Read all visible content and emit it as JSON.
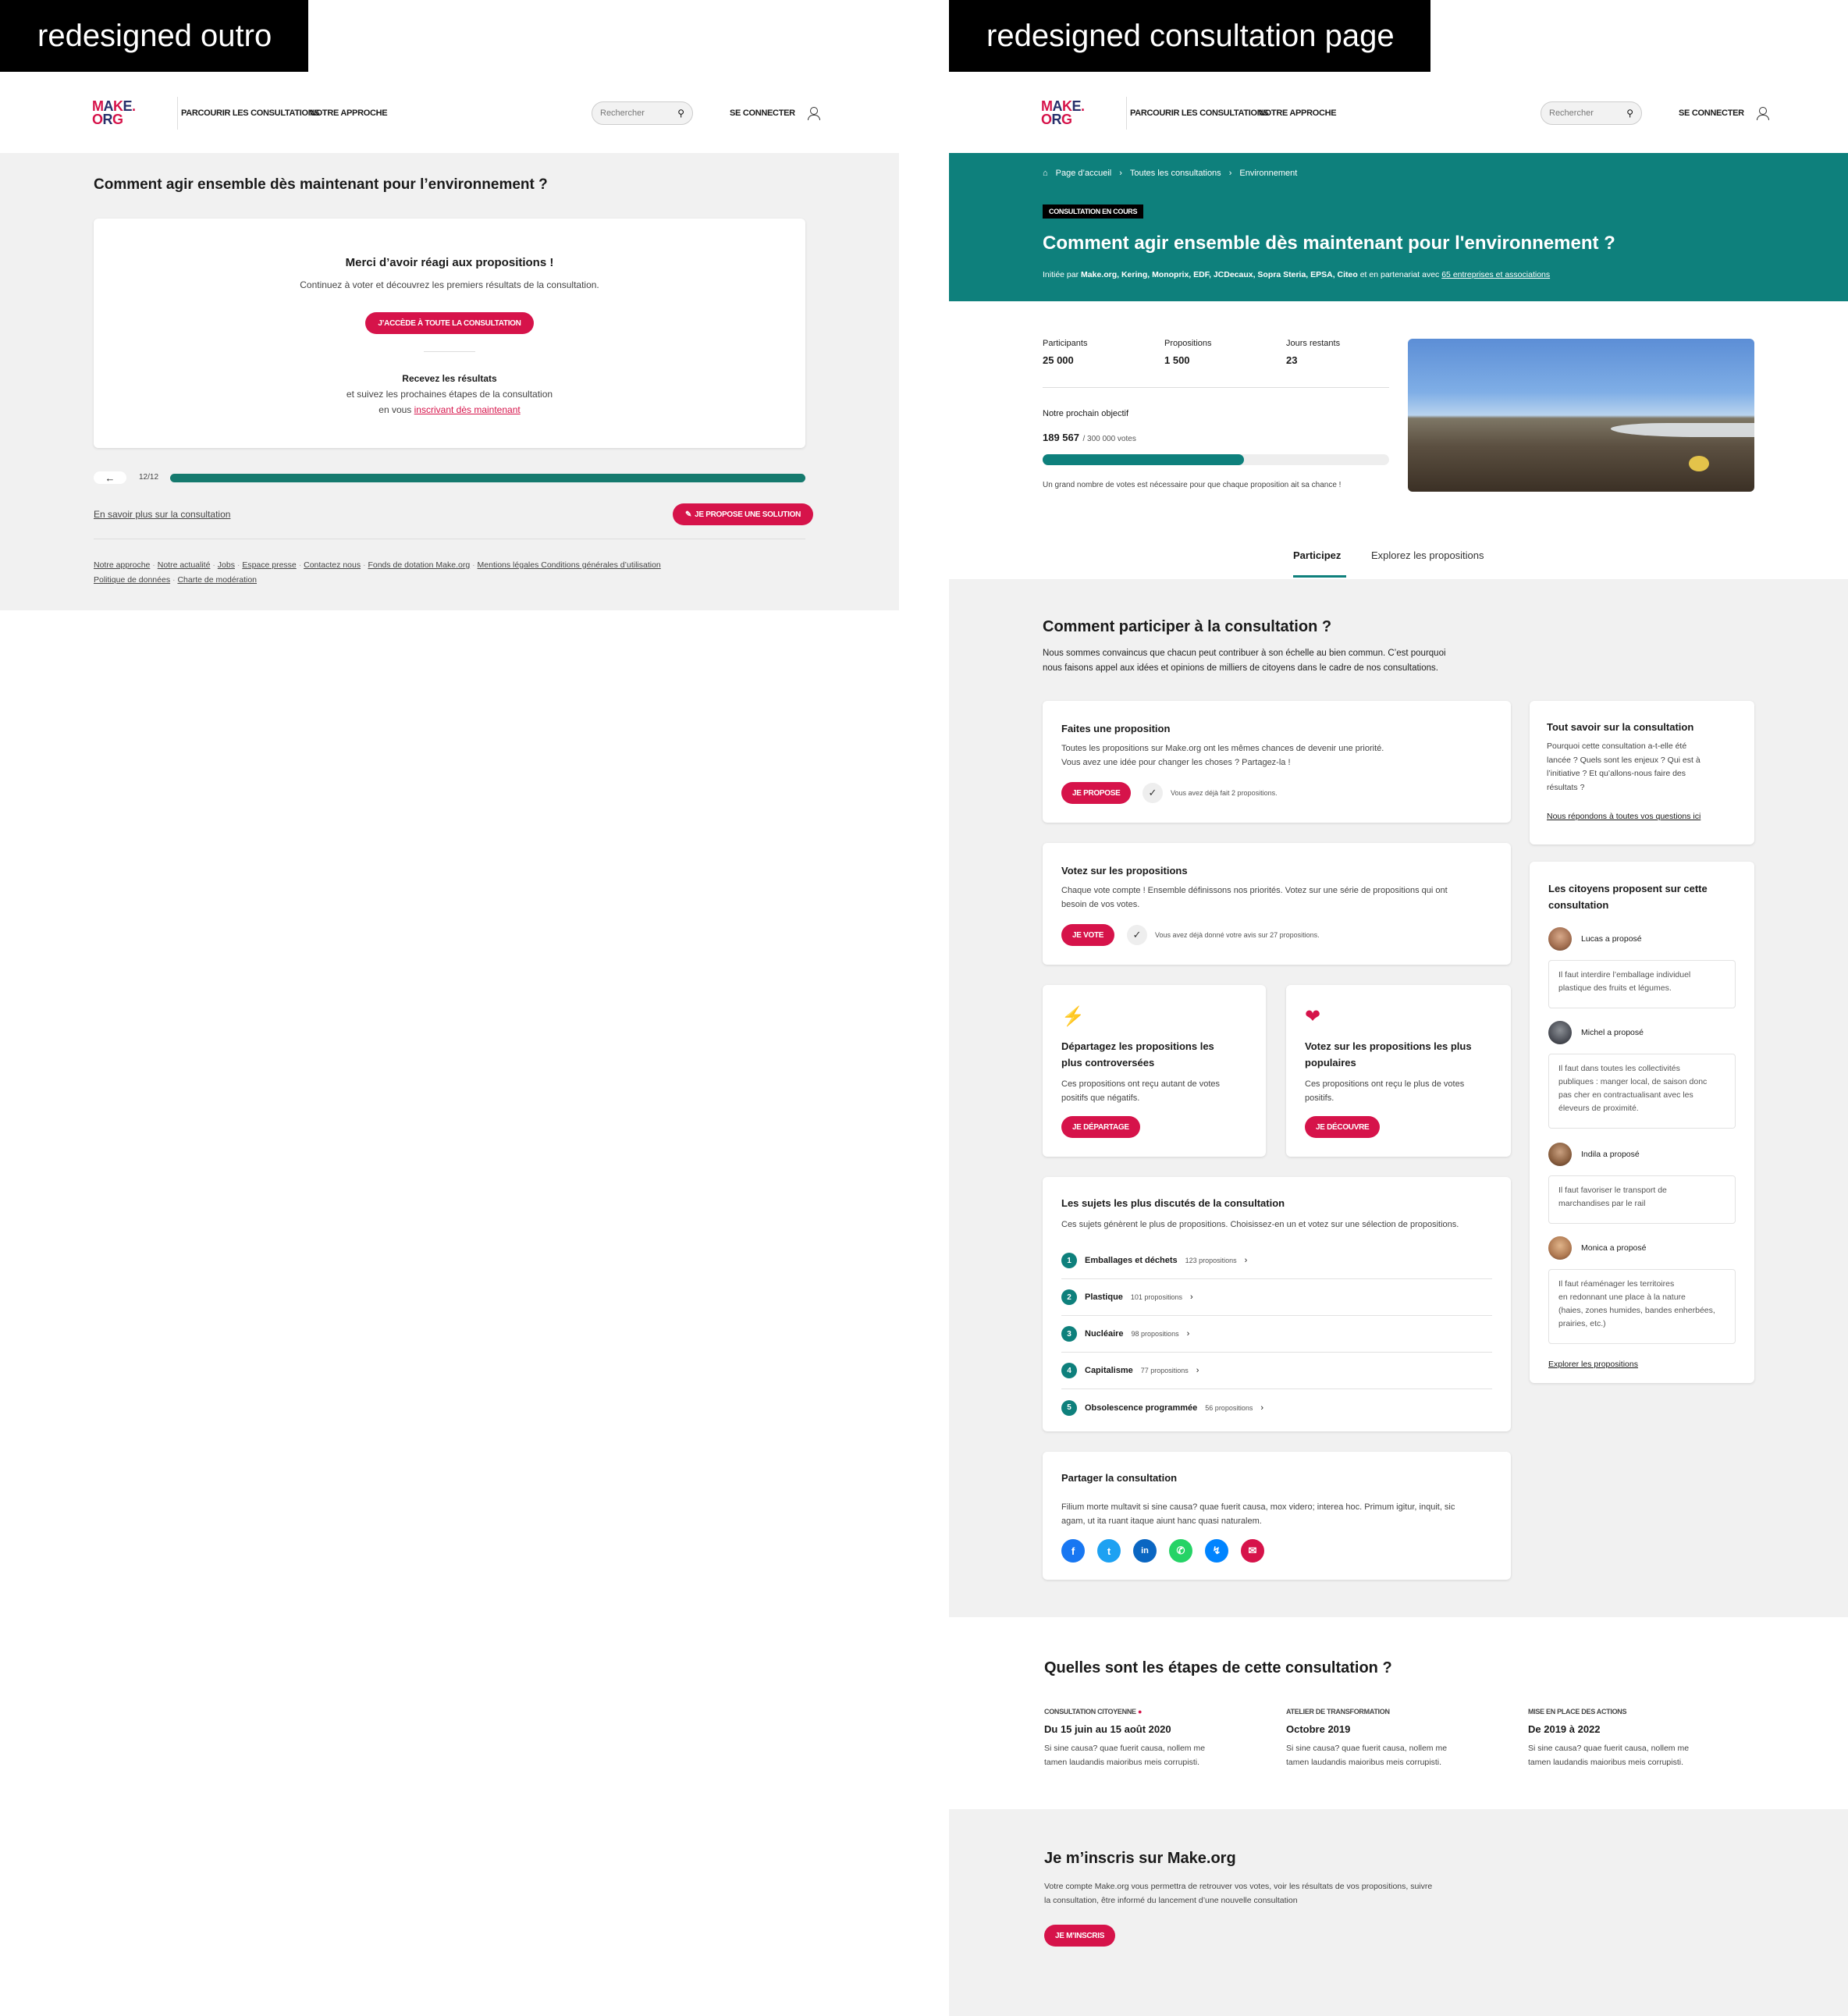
{
  "labels": {
    "left": "redesigned outro",
    "right": "redesigned consultation page"
  },
  "header": {
    "logo_top": "MAKE.",
    "logo_bottom": "ORG",
    "nav": [
      "PARCOURIR LES CONSULTATIONS",
      "NOTRE APPROCHE"
    ],
    "search_placeholder": "Rechercher",
    "login": "SE CONNECTER"
  },
  "outro": {
    "title": "Comment agir ensemble dès maintenant pour l’environnement ?",
    "thanks_title": "Merci d’avoir réagi aux propositions !",
    "thanks_text": "Continuez à voter et découvrez les premiers résultats de la consultation.",
    "access_button": "J’ACCÈDE À TOUTE LA CONSULTATION",
    "results_title": "Recevez les résultats",
    "results_line1": "et suivez les prochaines étapes de la consultation",
    "results_line2_prefix": "en vous",
    "results_link": "inscrivant dès maintenant",
    "progress_label": "12/12",
    "progress_fraction": 1.0,
    "learn_more": "En savoir plus sur la consultation",
    "propose_button": "JE PROPOSE UNE SOLUTION",
    "footer_links_row1": [
      "Notre approche",
      "Notre actualité",
      "Jobs",
      "Espace presse",
      "Contactez nous",
      "Fonds de dotation Make.org",
      "Mentions légales Conditions générales d’utilisation"
    ],
    "footer_links_row2": [
      "Politique de données",
      "Charte de modération"
    ]
  },
  "page": {
    "breadcrumb": [
      "Page d’accueil",
      "Toutes les consultations",
      "Environnement"
    ],
    "status_tag": "CONSULTATION EN COURS",
    "title": "Comment agir ensemble dès maintenant pour l'environnement ?",
    "initiated_prefix": "Initiée par",
    "initiated_by": "Make.org, Kering, Monoprix, EDF, JCDecaux, Sopra Steria, EPSA, Citeo",
    "partner_text": "et en partenariat avec",
    "partner_link": "65 entreprises et associations",
    "stats": [
      {
        "label": "Participants",
        "value": "25 000"
      },
      {
        "label": "Propositions",
        "value": "1 500"
      },
      {
        "label": "Jours restants",
        "value": "23"
      }
    ],
    "objective_label": "Notre prochain objectif",
    "objective_value": "189 567",
    "objective_total": "/ 300 000 votes",
    "objective_fraction": 0.58,
    "objective_note": "Un grand nombre de votes est nécessaire pour que chaque proposition ait sa chance !",
    "tabs": [
      "Participez",
      "Explorez les propositions"
    ],
    "participate_title": "Comment participer à la consultation ?",
    "participate_text1": "Nous sommes convaincus que chacun peut contribuer à son échelle au bien commun. C’est pourquoi",
    "participate_text2": "nous faisons appel aux idées et opinions de milliers de citoyens dans le cadre de nos consultations.",
    "propose": {
      "title": "Faites une proposition",
      "text1": "Toutes les propositions sur Make.org ont les mêmes chances de devenir une priorité.",
      "text2": "Vous avez une idée pour changer les choses ? Partagez-la !",
      "button": "JE PROPOSE",
      "status": "Vous avez déjà fait 2 propositions."
    },
    "vote": {
      "title": "Votez sur les propositions",
      "text1": "Chaque vote compte ! Ensemble définissons nos priorités. Votez sur une série de propositions qui ont",
      "text2": "besoin de vos votes.",
      "button": "JE VOTE",
      "status": "Vous avez déjà donné votre avis sur 27 propositions."
    },
    "controversial": {
      "title1": "Départagez les propositions les",
      "title2": "plus controversées",
      "text1": "Ces propositions ont reçu autant de votes",
      "text2": "positifs que négatifs.",
      "button": "JE DÉPARTAGE",
      "icon": "lightning-icon",
      "color": "#f5b700"
    },
    "popular": {
      "title1": "Votez sur les propositions les plus",
      "title2": "populaires",
      "text1": "Ces propositions ont reçu le plus de votes",
      "text2": "positifs.",
      "button": "JE DÉCOUVRE",
      "icon": "heart-icon",
      "color": "#d6134a"
    },
    "topics": {
      "title": "Les sujets les plus discutés de la consultation",
      "text": "Ces sujets génèrent le plus de propositions. Choisissez-en un et votez sur une sélection de propositions.",
      "items": [
        {
          "n": "1",
          "name": "Emballages et déchets",
          "count": "123 propositions"
        },
        {
          "n": "2",
          "name": "Plastique",
          "count": "101 propositions"
        },
        {
          "n": "3",
          "name": "Nucléaire",
          "count": "98 propositions"
        },
        {
          "n": "4",
          "name": "Capitalisme",
          "count": "77 propositions"
        },
        {
          "n": "5",
          "name": "Obsolescence programmée",
          "count": "56 propositions"
        }
      ]
    },
    "share": {
      "title": "Partager la consultation",
      "text1": "Filium morte multavit si sine causa? quae fuerit causa, mox videro; interea hoc. Primum igitur, inquit, sic",
      "text2": "agam, ut ita ruant itaque aiunt hanc quasi naturalem."
    },
    "about": {
      "title": "Tout savoir sur la consultation",
      "lines": [
        "Pourquoi cette consultation a-t-elle été",
        "lancée ? Quels sont les enjeux ? Qui est à",
        "l’initiative ? Et qu’allons-nous faire des",
        "résultats ?"
      ],
      "link": "Nous répondons à toutes vos questions ici"
    },
    "citizens": {
      "title1": "Les citoyens proposent sur cette",
      "title2": "consultation",
      "items": [
        {
          "who": "Lucas a proposé",
          "lines": [
            "Il faut interdire l’emballage individuel",
            "plastique des fruits et légumes."
          ]
        },
        {
          "who": "Michel a proposé",
          "lines": [
            "Il faut dans toutes les collectivités",
            "publiques : manger local, de saison donc",
            "pas cher en contractualisant avec les",
            "éleveurs de proximité."
          ]
        },
        {
          "who": "Indila a proposé",
          "lines": [
            "Il faut favoriser le transport de",
            "marchandises par le rail"
          ]
        },
        {
          "who": "Monica a proposé",
          "lines": [
            "Il faut réaménager les territoires",
            "en redonnant une place à la nature",
            "(haies, zones humides, bandes enherbées,",
            "prairies, etc.)"
          ]
        }
      ],
      "link": "Explorer les propositions"
    },
    "steps": {
      "title": "Quelles sont les étapes de cette consultation ?",
      "items": [
        {
          "tag": "CONSULTATION CITOYENNE",
          "date": "Du 15 juin au 15 août 2020",
          "text1": "Si sine causa? quae fuerit causa, nollem me",
          "text2": "tamen laudandis maioribus meis corrupisti."
        },
        {
          "tag": "ATELIER DE TRANSFORMATION",
          "date": "Octobre 2019",
          "text1": "Si sine causa? quae fuerit causa, nollem me",
          "text2": "tamen laudandis maioribus meis corrupisti."
        },
        {
          "tag": "MISE EN PLACE DES ACTIONS",
          "date": "De 2019 à 2022",
          "text1": "Si sine causa? quae fuerit causa, nollem me",
          "text2": "tamen laudandis maioribus meis corrupisti."
        }
      ]
    },
    "signup": {
      "title": "Je m’inscris sur Make.org",
      "text1": "Votre compte Make.org vous permettra de retrouver vos votes, voir les résultats de vos propositions, suivre",
      "text2": "la consultation, être informé du lancement d’une nouvelle consultation",
      "button": "JE M’INSCRIS"
    }
  },
  "colors": {
    "brand_red": "#d6134a",
    "brand_teal": "#0e807c",
    "brand_navy": "#262f6b"
  }
}
